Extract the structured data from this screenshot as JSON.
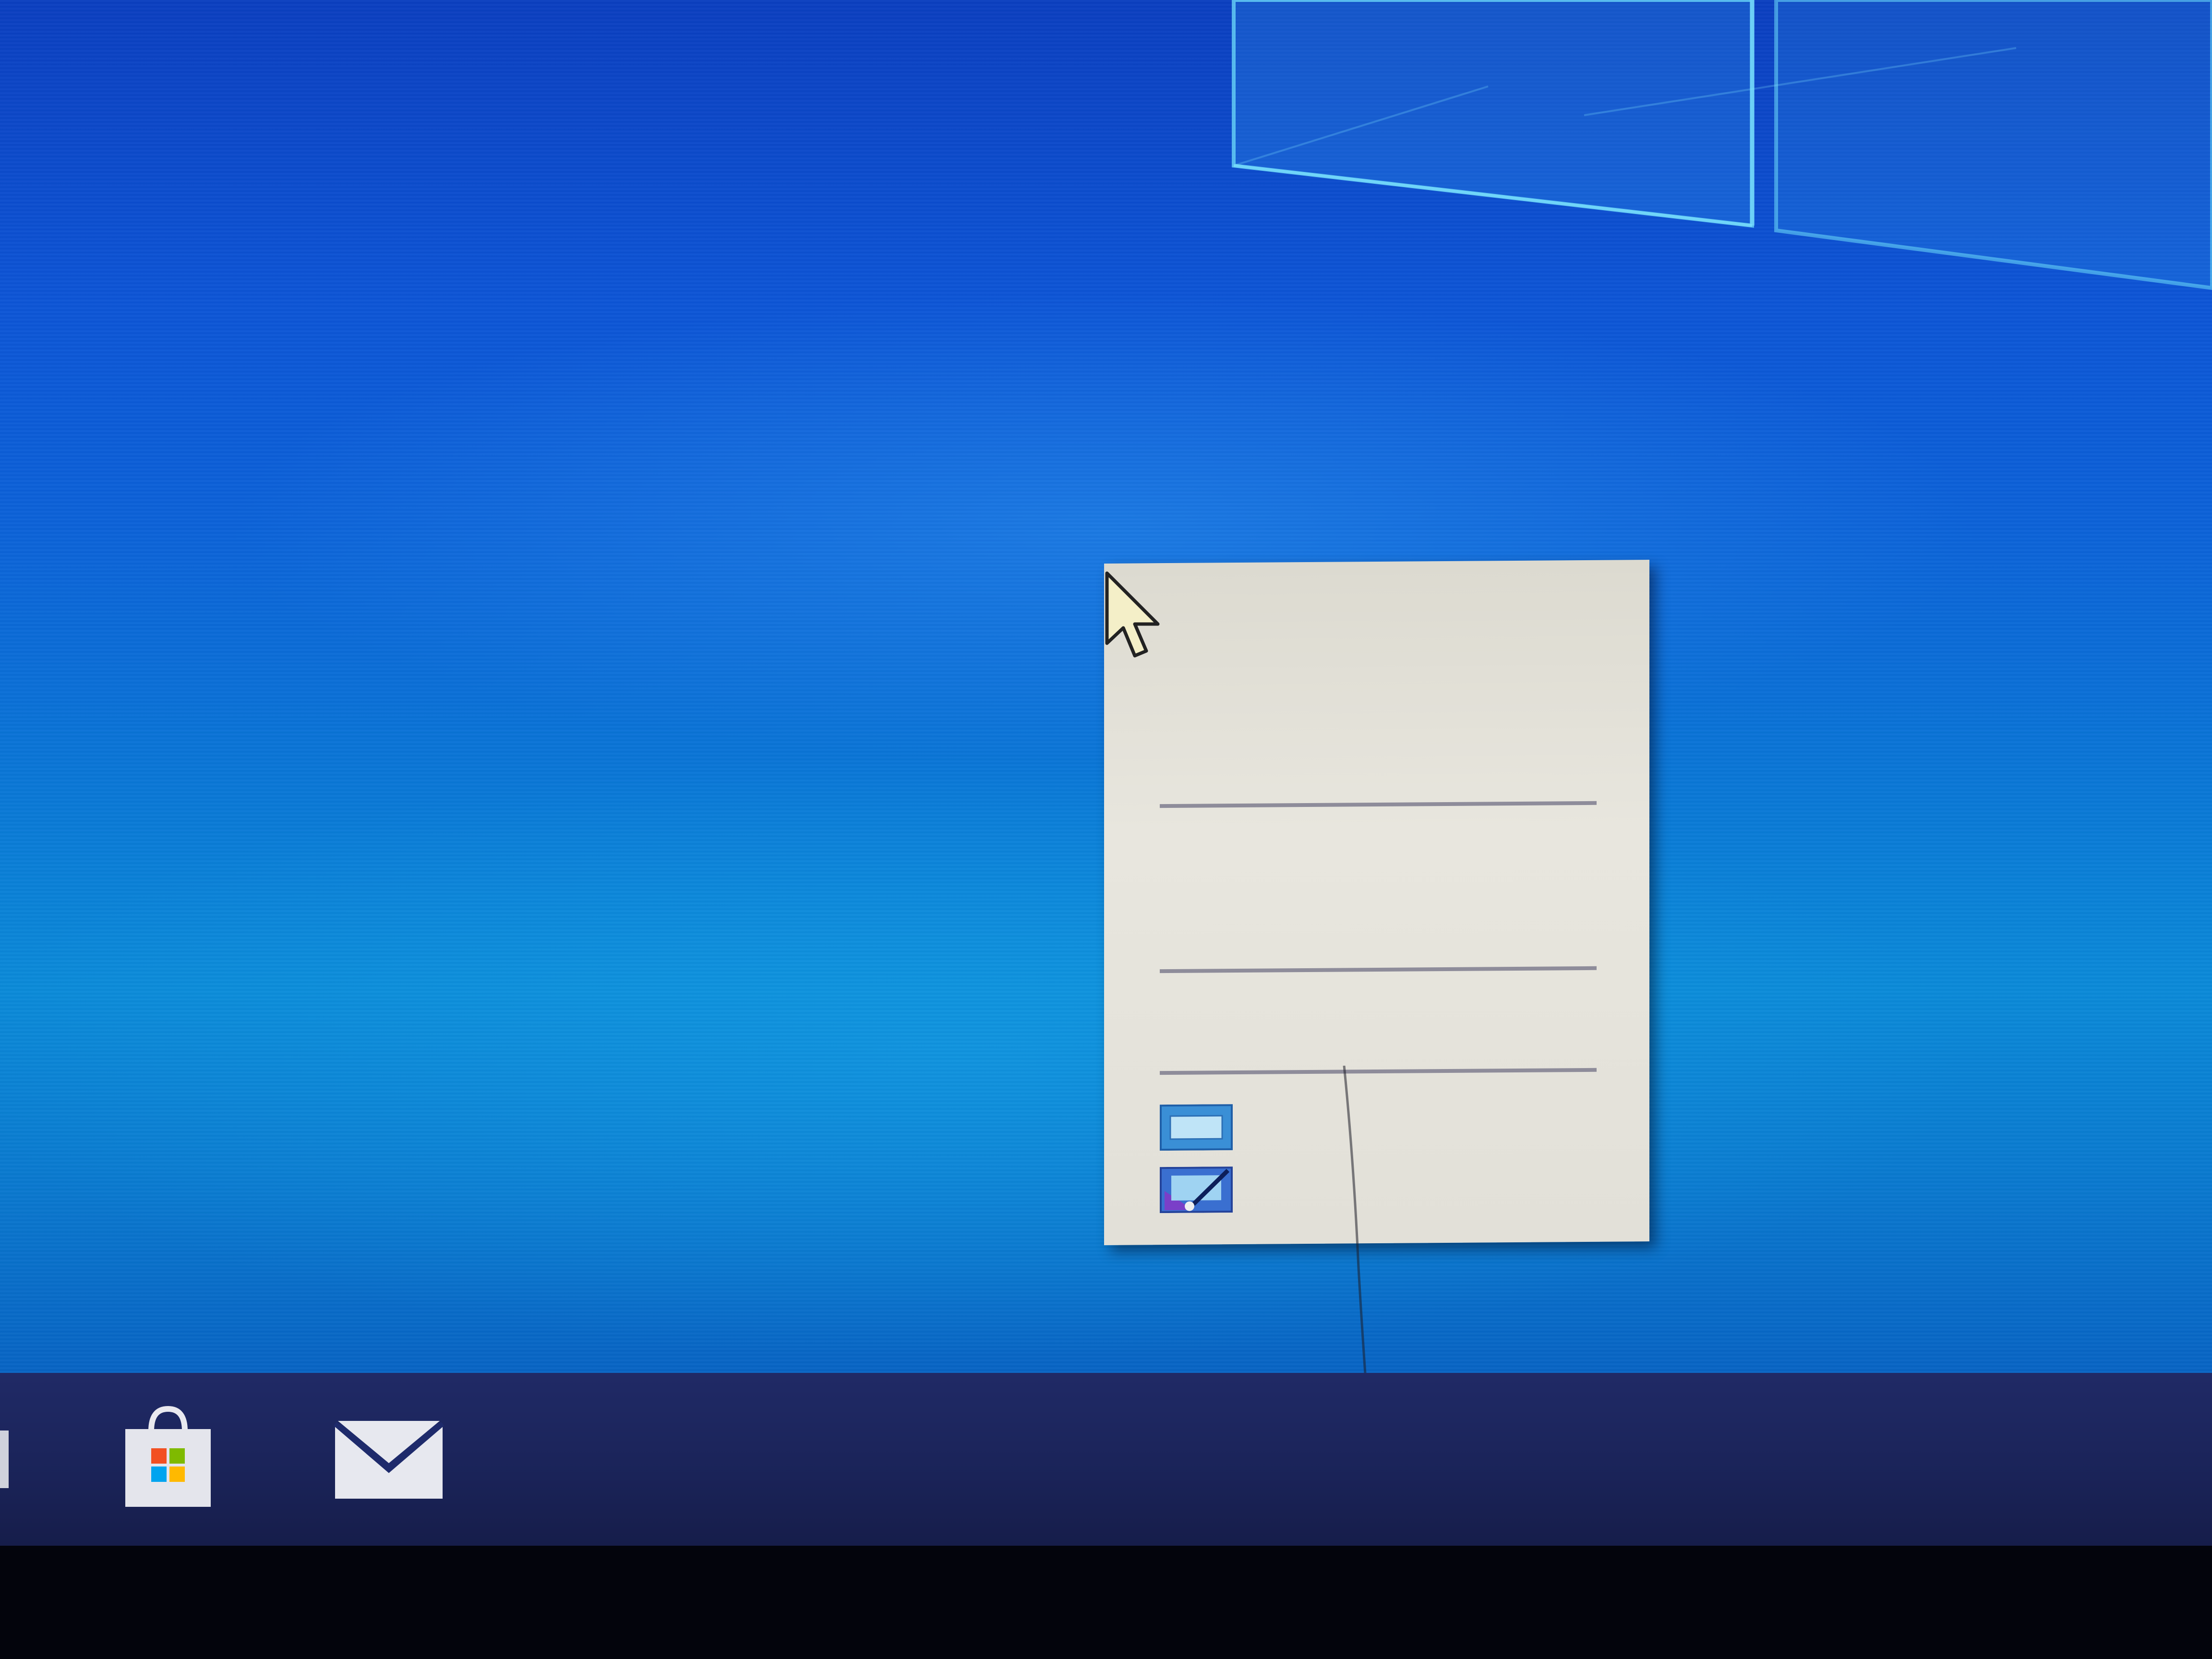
{
  "desktop": {
    "wallpaper": "windows-10-hero-blue",
    "accent_color": "#0b62d6"
  },
  "context_menu": {
    "background_color": "#e4e2da",
    "separator_color": "#8e8c9a",
    "items": [
      {
        "label": ""
      },
      {
        "label": ""
      },
      {
        "label": ""
      },
      {
        "label": ""
      },
      {
        "label": ""
      }
    ],
    "icons": [
      "display-settings-icon",
      "personalize-icon"
    ]
  },
  "cursor": {
    "icon": "arrow-cursor-icon"
  },
  "taskbar": {
    "background_color": "#1c2560",
    "apps": [
      {
        "icon": "microsoft-store-icon"
      },
      {
        "icon": "mail-icon"
      }
    ]
  }
}
